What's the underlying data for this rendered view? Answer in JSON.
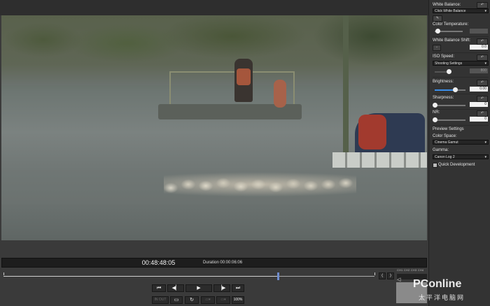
{
  "panel": {
    "white_balance_label": "White Balance:",
    "white_balance_value": "Click White Balance",
    "color_temp_label": "Color Temperature:",
    "wb_shift_label": "White Balance Shift:",
    "wb_shift_value": "0.0",
    "iso_label": "ISO Speed:",
    "iso_value": "Shooting Settings",
    "iso_input": "800",
    "brightness_label": "Brightness:",
    "brightness_value": "0.00",
    "brightness_level": 0.65,
    "sharpness_label": "Sharpness:",
    "sharpness_value": "0",
    "nr_label": "NR:",
    "nr_value": "0",
    "preview_label": "Preview Settings",
    "color_space_label": "Color Space:",
    "color_space_value": "Cinema Gamut",
    "gamma_label": "Gamma:",
    "gamma_value": "Canon Log 2",
    "quick_dev_label": "Quick Development",
    "reset_icon": "reset-arrow-icon"
  },
  "player": {
    "timecode": "00:48:48:05",
    "duration": "Duration 00:00:06:06",
    "progress": 0.74,
    "transport": {
      "first": "⏮",
      "prev_frame": "◀▏",
      "play": "▶",
      "next_frame": "▕▶",
      "last": "⏭",
      "in_out": "IN OUT",
      "zoom": "100%"
    },
    "channels": "CH1 CH2 CH3 CH4"
  },
  "watermark": {
    "brand": "PConline",
    "sub": "太平洋电脑网"
  },
  "colors": {
    "accent": "#3b8eea",
    "panel_bg": "#333333",
    "app_bg": "#3b3b3b"
  }
}
